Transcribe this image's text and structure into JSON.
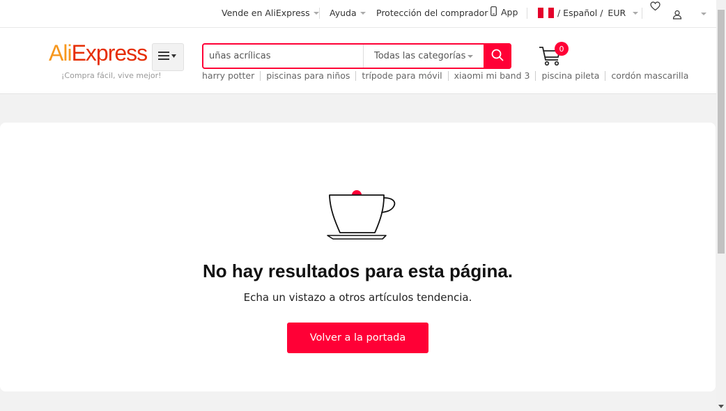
{
  "topbar": {
    "sell": "Vende en AliExpress",
    "help": "Ayuda",
    "protection": "Protección del comprador",
    "app": "App",
    "language": "/ Español /",
    "currency": "EUR"
  },
  "header": {
    "logo_part1": "Ali",
    "logo_part2": "Express",
    "slogan": "¡Compra fácil, vive mejor!",
    "search_value": "uñas acrílicas",
    "category": "Todas las categorías",
    "cart_count": "0",
    "hot_words": [
      "harry potter",
      "piscinas para niños",
      "trípode para móvil",
      "xiaomi mi band 3",
      "piscina pileta",
      "cordón mascarilla"
    ]
  },
  "empty": {
    "title": "No hay resultados para esta página.",
    "subtitle": "Echa un vistazo a otros artículos tendencia.",
    "button": "Volver a la portada"
  },
  "colors": {
    "accent": "#ff0036",
    "logo_orange": "#f7971d",
    "logo_red": "#e62e04"
  },
  "icons": [
    "phone-icon",
    "peru-flag-icon",
    "heart-icon",
    "user-icon",
    "menu-icon",
    "search-icon",
    "cart-icon",
    "coffee-cup-icon"
  ]
}
